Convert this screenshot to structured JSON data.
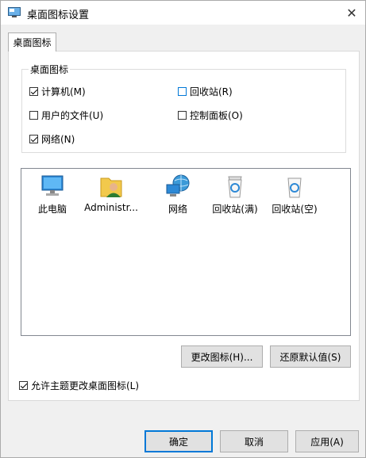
{
  "window": {
    "title": "桌面图标设置"
  },
  "tab": {
    "label": "桌面图标"
  },
  "group": {
    "legend": "桌面图标",
    "checkboxes": [
      {
        "label": "计算机(M)",
        "checked": true
      },
      {
        "label": "回收站(R)",
        "checked": false
      },
      {
        "label": "用户的文件(U)",
        "checked": false
      },
      {
        "label": "控制面板(O)",
        "checked": false
      },
      {
        "label": "网络(N)",
        "checked": true
      }
    ]
  },
  "icons": [
    {
      "label": "此电脑",
      "icon": "computer-icon"
    },
    {
      "label": "Administr...",
      "icon": "user-folder-icon"
    },
    {
      "label": "网络",
      "icon": "network-icon"
    },
    {
      "label": "回收站(满)",
      "icon": "recycle-bin-full-icon"
    },
    {
      "label": "回收站(空)",
      "icon": "recycle-bin-empty-icon"
    }
  ],
  "buttons": {
    "change_icon": "更改图标(H)...",
    "restore_default": "还原默认值(S)",
    "ok": "确定",
    "cancel": "取消",
    "apply": "应用(A)"
  },
  "allow_theme": {
    "label": "允许主题更改桌面图标(L)",
    "checked": true
  },
  "colors": {
    "accent": "#0078d7",
    "window_bg": "#f0f0f0"
  }
}
